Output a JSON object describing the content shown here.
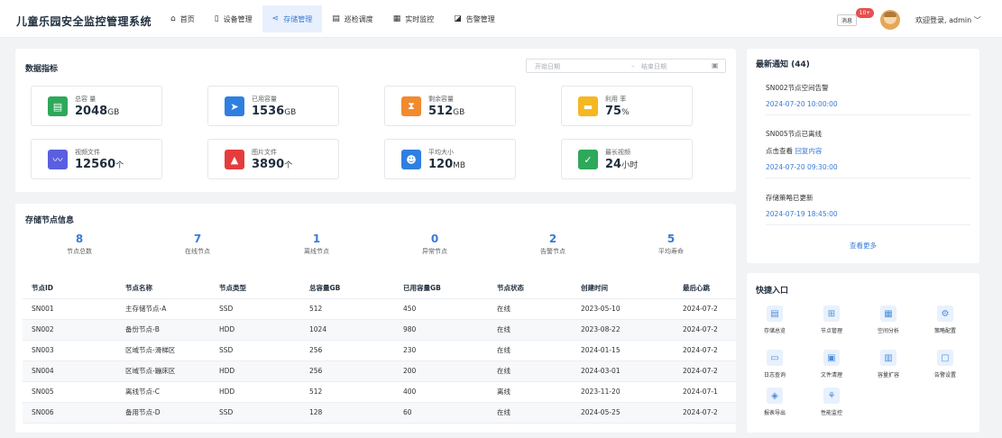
{
  "app": {
    "title": "儿童乐园安全监控管理系统"
  },
  "nav": [
    {
      "label": "首页",
      "icon": "home-icon",
      "glyph": "⌂",
      "active": false
    },
    {
      "label": "设备管理",
      "icon": "device-icon",
      "glyph": "▯",
      "active": false
    },
    {
      "label": "存储管理",
      "icon": "share-icon",
      "glyph": "⋖",
      "active": true
    },
    {
      "label": "巡检调度",
      "icon": "document-icon",
      "glyph": "▤",
      "active": false
    },
    {
      "label": "实时监控",
      "icon": "calendar-icon",
      "glyph": "▦",
      "active": false
    },
    {
      "label": "告警管理",
      "icon": "alert-icon",
      "glyph": "◪",
      "active": false
    }
  ],
  "header": {
    "messages_label": "消息",
    "badge": "10+",
    "user_label": "欢迎登录, admin ﹀"
  },
  "metrics": {
    "title": "数据指标",
    "date_start_placeholder": "开始日期",
    "date_separator": "–",
    "date_end_placeholder": "结束日期",
    "tiles": [
      {
        "label": "总容 量",
        "value": "2048",
        "unit": "GB",
        "icon": "file-icon",
        "glyph": "▤",
        "color": "#2ea85a"
      },
      {
        "label": "已用容量",
        "value": "1536",
        "unit": "GB",
        "icon": "send-icon",
        "glyph": "➤",
        "color": "#2f7fe0"
      },
      {
        "label": "剩余容量",
        "value": "512",
        "unit": "GB",
        "icon": "hourglass-icon",
        "glyph": "⧗",
        "color": "#f28a2e"
      },
      {
        "label": "利用 率",
        "value": "75",
        "unit": "%",
        "icon": "percent-icon",
        "glyph": "▬",
        "color": "#f5b722"
      },
      {
        "label": "视频文件",
        "value": "12560",
        "unit": "个",
        "icon": "trend-icon",
        "glyph": "〰",
        "color": "#5a5fe0"
      },
      {
        "label": "图片文件",
        "value": "3890",
        "unit": "个",
        "icon": "warning-icon",
        "glyph": "▲",
        "color": "#e53d3d"
      },
      {
        "label": "平均大小",
        "value": "120",
        "unit": "MB",
        "icon": "person-icon",
        "glyph": "☻",
        "color": "#2f7fe0"
      },
      {
        "label": "最长视频",
        "value": "24",
        "unit": "小时",
        "icon": "check-icon",
        "glyph": "✓",
        "color": "#2ea85a"
      }
    ]
  },
  "nodes": {
    "title": "存储节点信息",
    "stats": [
      {
        "value": "8",
        "label": "节点总数"
      },
      {
        "value": "7",
        "label": "在线节点"
      },
      {
        "value": "1",
        "label": "离线节点"
      },
      {
        "value": "0",
        "label": "异常节点"
      },
      {
        "value": "2",
        "label": "告警节点"
      },
      {
        "value": "5",
        "label": "平均寿命"
      }
    ],
    "columns": [
      "节点ID",
      "节点名称",
      "节点类型",
      "总容量GB",
      "已用容量GB",
      "节点状态",
      "创建时间",
      "最后心跳"
    ],
    "rows": [
      [
        "SN001",
        "主存储节点-A",
        "SSD",
        "512",
        "450",
        "在线",
        "2023-05-10",
        "2024-07-2"
      ],
      [
        "SN002",
        "备份节点-B",
        "HDD",
        "1024",
        "980",
        "在线",
        "2023-08-22",
        "2024-07-2"
      ],
      [
        "SN003",
        "区域节点-滑梯区",
        "SSD",
        "256",
        "230",
        "在线",
        "2024-01-15",
        "2024-07-2"
      ],
      [
        "SN004",
        "区域节点-蹦床区",
        "HDD",
        "256",
        "200",
        "在线",
        "2024-03-01",
        "2024-07-2"
      ],
      [
        "SN005",
        "离线节点-C",
        "HDD",
        "512",
        "400",
        "离线",
        "2023-11-20",
        "2024-07-1"
      ],
      [
        "SN006",
        "备用节点-D",
        "SSD",
        "128",
        "60",
        "在线",
        "2024-05-25",
        "2024-07-2"
      ]
    ]
  },
  "notices": {
    "title": "最新通知 (44)",
    "items": [
      {
        "title": "SN002节点空间告警",
        "time": "2024-07-20 10:00:00"
      },
      {
        "title": "SN005节点已离线",
        "action_prefix": "点击查看 ",
        "action_link": "回复内容",
        "time": "2024-07-20 09:30:00"
      },
      {
        "title": "存储策略已更新",
        "time": "2024-07-19 18:45:00"
      }
    ],
    "more": "查看更多"
  },
  "quick": {
    "title": "快捷入口",
    "items": [
      {
        "label": "存储总览",
        "icon": "overview-icon",
        "glyph": "▤"
      },
      {
        "label": "节点管理",
        "icon": "node-icon",
        "glyph": "⊞"
      },
      {
        "label": "空间分析",
        "icon": "analysis-icon",
        "glyph": "▦"
      },
      {
        "label": "策略配置",
        "icon": "config-icon",
        "glyph": "⚙"
      },
      {
        "label": "日志查询",
        "icon": "folder-icon",
        "glyph": "▭"
      },
      {
        "label": "文件清理",
        "icon": "clean-icon",
        "glyph": "▣"
      },
      {
        "label": "容量扩容",
        "icon": "bar-chart-icon",
        "glyph": "▥"
      },
      {
        "label": "告警设置",
        "icon": "alarm-icon",
        "glyph": "▢"
      },
      {
        "label": "报表导出",
        "icon": "layers-icon",
        "glyph": "◈"
      },
      {
        "label": "性能监控",
        "icon": "monitor-icon",
        "glyph": "⚘"
      }
    ]
  }
}
